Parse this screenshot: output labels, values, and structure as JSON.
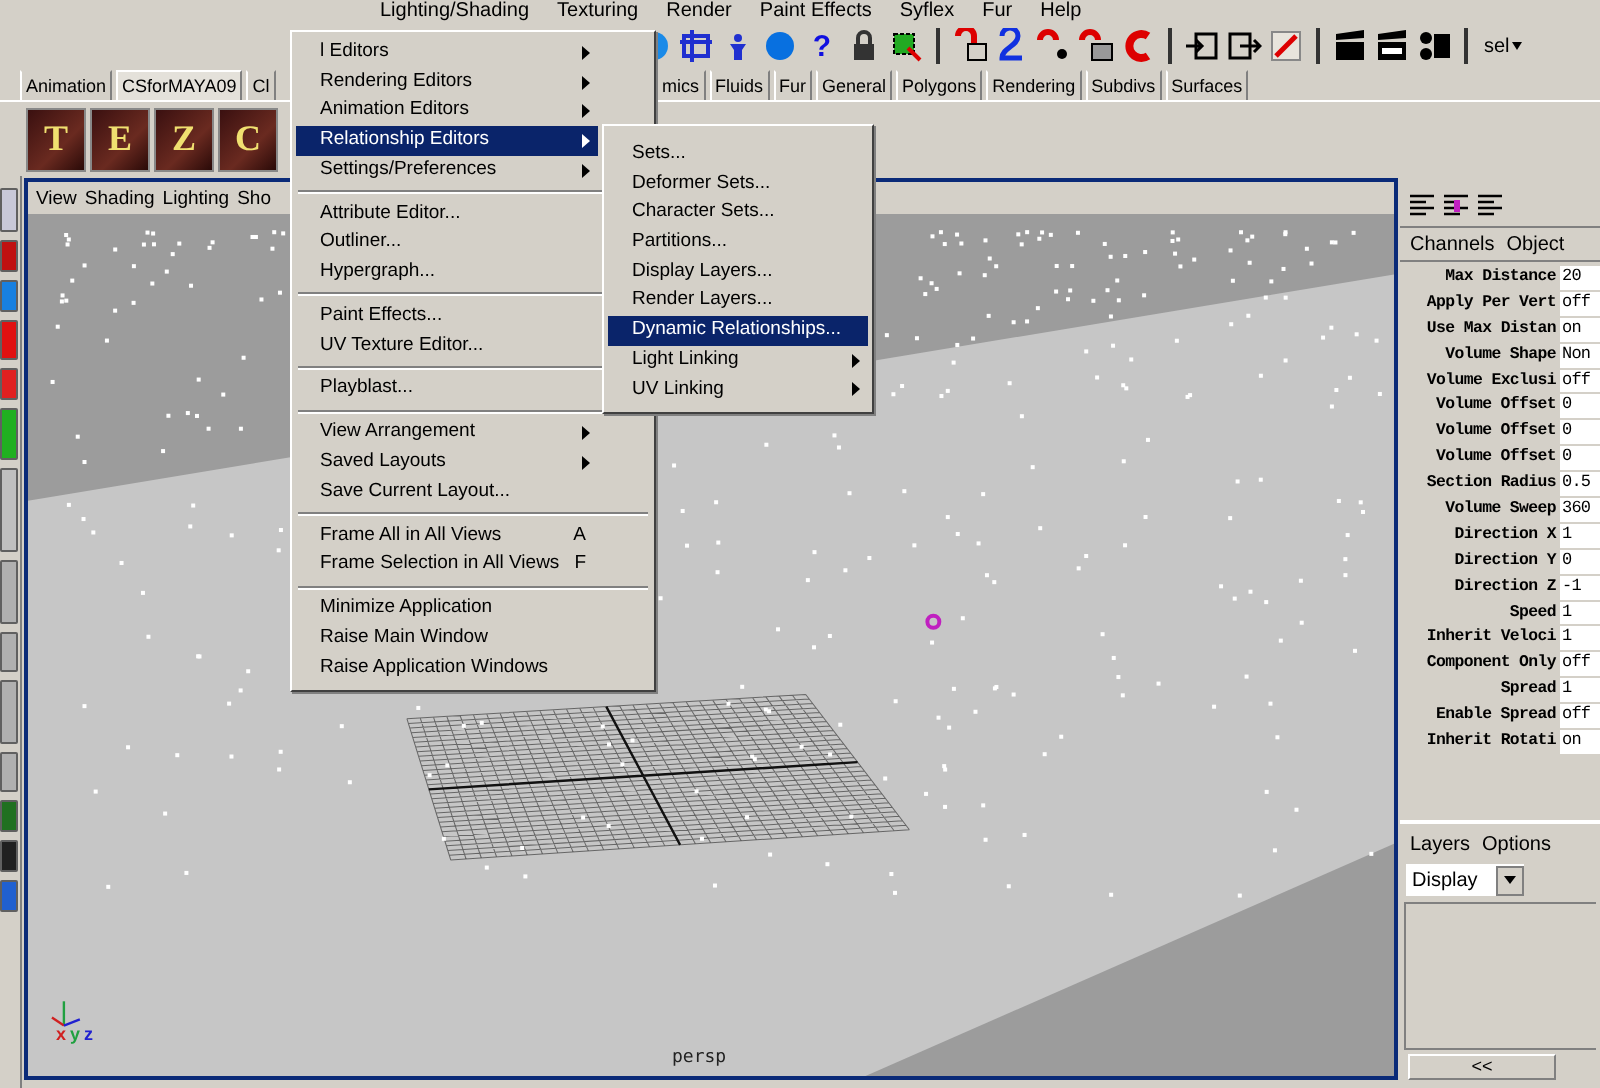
{
  "menubar": [
    "Lighting/Shading",
    "Texturing",
    "Render",
    "Paint Effects",
    "Syflex",
    "Fur",
    "Help"
  ],
  "toolbar": {
    "help_glyph": "?",
    "selector": "sel"
  },
  "shelf_tabs": {
    "left": [
      {
        "label": "Animation",
        "selected": false
      },
      {
        "label": "CSforMAYA09",
        "selected": true
      },
      {
        "label": "Cl",
        "selected": false
      }
    ],
    "right": [
      {
        "label": "mics",
        "selected": false
      },
      {
        "label": "Fluids",
        "selected": false
      },
      {
        "label": "Fur",
        "selected": false
      },
      {
        "label": "General",
        "selected": false
      },
      {
        "label": "Polygons",
        "selected": false
      },
      {
        "label": "Rendering",
        "selected": false
      },
      {
        "label": "Subdivs",
        "selected": false
      },
      {
        "label": "Surfaces",
        "selected": false
      }
    ]
  },
  "shelf_buttons": [
    {
      "letter": "T"
    },
    {
      "letter": "E"
    },
    {
      "letter": "Z"
    },
    {
      "letter": "C"
    }
  ],
  "viewport": {
    "menu": [
      "View",
      "Shading",
      "Lighting",
      "Sho"
    ],
    "camera": "persp",
    "axes": [
      "x",
      "y",
      "z"
    ]
  },
  "main_menu": {
    "groups": [
      [
        {
          "label": "l Editors",
          "kind": "submenu",
          "selected": false
        },
        {
          "label": "Rendering Editors",
          "kind": "submenu",
          "selected": false
        },
        {
          "label": "Animation Editors",
          "kind": "submenu",
          "selected": false
        },
        {
          "label": "Relationship Editors",
          "kind": "submenu",
          "selected": true
        },
        {
          "label": "Settings/Preferences",
          "kind": "submenu",
          "selected": false
        }
      ],
      [
        {
          "label": "Attribute Editor...",
          "kind": "item",
          "selected": false
        },
        {
          "label": "Outliner...",
          "kind": "item",
          "selected": false
        },
        {
          "label": "Hypergraph...",
          "kind": "item",
          "selected": false
        }
      ],
      [
        {
          "label": "Paint Effects...",
          "kind": "item",
          "selected": false
        },
        {
          "label": "UV Texture Editor...",
          "kind": "item",
          "selected": false
        }
      ],
      [
        {
          "label": "Playblast...",
          "kind": "item",
          "selected": false
        }
      ],
      [
        {
          "label": "View Arrangement",
          "kind": "submenu",
          "selected": false
        },
        {
          "label": "Saved Layouts",
          "kind": "submenu",
          "selected": false
        },
        {
          "label": "Save Current Layout...",
          "kind": "item",
          "selected": false
        }
      ],
      [
        {
          "label": "Frame All in All Views",
          "kind": "item",
          "selected": false,
          "shortcut": "A"
        },
        {
          "label": "Frame Selection in All Views",
          "kind": "item",
          "selected": false,
          "shortcut": "F"
        }
      ],
      [
        {
          "label": "Minimize Application",
          "kind": "item",
          "selected": false
        },
        {
          "label": "Raise Main Window",
          "kind": "item",
          "selected": false
        },
        {
          "label": "Raise Application Windows",
          "kind": "item",
          "selected": false
        }
      ]
    ]
  },
  "submenu": {
    "items": [
      {
        "label": "Sets...",
        "kind": "item",
        "selected": false
      },
      {
        "label": "Deformer Sets...",
        "kind": "item",
        "selected": false
      },
      {
        "label": "Character Sets...",
        "kind": "item",
        "selected": false
      },
      {
        "label": "Partitions...",
        "kind": "item",
        "selected": false
      },
      {
        "label": "Display Layers...",
        "kind": "item",
        "selected": false
      },
      {
        "label": "Render Layers...",
        "kind": "item",
        "selected": false
      },
      {
        "label": "Dynamic Relationships...",
        "kind": "item",
        "selected": true
      },
      {
        "label": "Light Linking",
        "kind": "submenu",
        "selected": false
      },
      {
        "label": "UV Linking",
        "kind": "submenu",
        "selected": false
      }
    ]
  },
  "channel_box": {
    "menu": [
      "Channels",
      "Object"
    ],
    "attributes": [
      {
        "name": "Max Distance",
        "value": "20"
      },
      {
        "name": "Apply Per Vert",
        "value": "off"
      },
      {
        "name": "Use Max Distan",
        "value": "on"
      },
      {
        "name": "Volume Shape",
        "value": "Non"
      },
      {
        "name": "Volume Exclusi",
        "value": "off"
      },
      {
        "name": "Volume Offset",
        "value": "0"
      },
      {
        "name": "Volume Offset",
        "value": "0"
      },
      {
        "name": "Volume Offset",
        "value": "0"
      },
      {
        "name": "Section Radius",
        "value": "0.5"
      },
      {
        "name": "Volume Sweep",
        "value": "360"
      },
      {
        "name": "Direction X",
        "value": "1"
      },
      {
        "name": "Direction Y",
        "value": "0"
      },
      {
        "name": "Direction Z",
        "value": "-1"
      },
      {
        "name": "Speed",
        "value": "1"
      },
      {
        "name": "Inherit Veloci",
        "value": "1"
      },
      {
        "name": "Component Only",
        "value": "off"
      },
      {
        "name": "Spread",
        "value": "1"
      },
      {
        "name": "Enable Spread",
        "value": "off"
      },
      {
        "name": "Inherit Rotati",
        "value": "on"
      }
    ]
  },
  "layers": {
    "menu": [
      "Layers",
      "Options"
    ],
    "mode": "Display",
    "collapse_button": "<<"
  }
}
